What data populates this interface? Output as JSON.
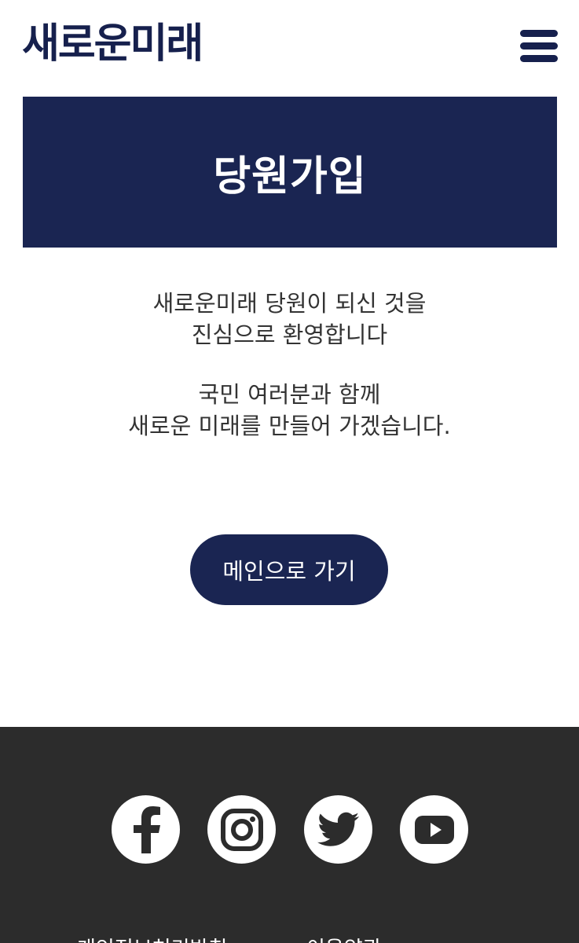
{
  "header": {
    "logo_text": "새로운미래",
    "menu_icon": "hamburger-menu-icon"
  },
  "banner": {
    "title": "당원가입"
  },
  "welcome": {
    "lines": [
      "새로운미래 당원이 되신 것을",
      "진심으로 환영합니다",
      "국민 여러분과 함께",
      "새로운 미래를 만들어 가겠습니다."
    ]
  },
  "main_button": {
    "label": "메인으로 가기"
  },
  "footer": {
    "social": [
      {
        "name": "facebook",
        "icon": "facebook-icon"
      },
      {
        "name": "instagram",
        "icon": "instagram-icon"
      },
      {
        "name": "twitter",
        "icon": "twitter-icon"
      },
      {
        "name": "youtube",
        "icon": "youtube-icon"
      }
    ],
    "links": [
      "개인정보처리방침",
      "이용약관"
    ]
  },
  "colors": {
    "brand_navy": "#1a2552",
    "logo_navy": "#16204d",
    "footer_bg": "#2c2c2c"
  }
}
